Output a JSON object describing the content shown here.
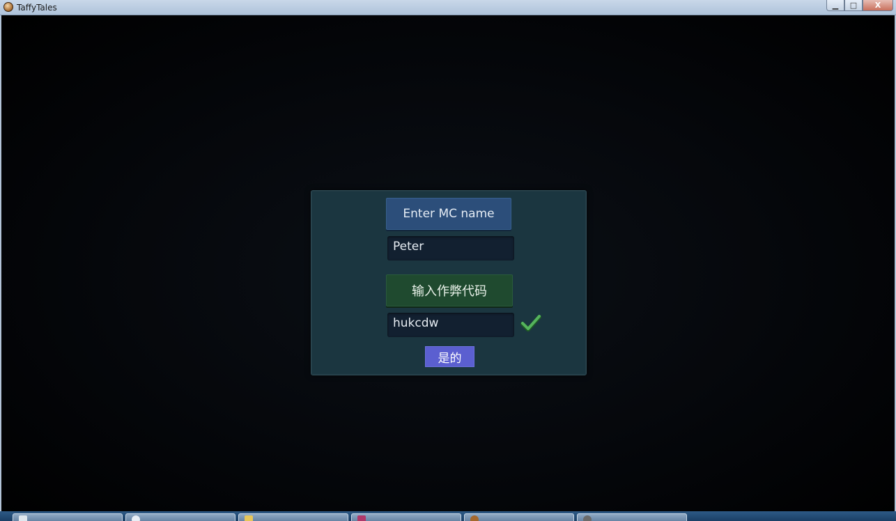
{
  "window": {
    "title": "TaffyTales",
    "controls": {
      "minimize": "▁",
      "maximize": "□",
      "close": "X"
    }
  },
  "dialog": {
    "name_button_label": "Enter MC name",
    "name_value": "Peter",
    "cheat_button_label": "输入作弊代码",
    "cheat_value": "hukcdw",
    "confirm_label": "是的",
    "status_icon": "checkmark-icon"
  },
  "colors": {
    "panel": "#1b3640",
    "name_button": "#2c4e7a",
    "cheat_button": "#1f4a2f",
    "confirm_button": "#5b5fd0",
    "check": "#4caf50"
  },
  "taskbar": {
    "items": [
      {
        "icon": "notepad-icon"
      },
      {
        "icon": "browser-icon"
      },
      {
        "icon": "folder-icon"
      },
      {
        "icon": "archive-icon"
      },
      {
        "icon": "game-icon"
      },
      {
        "icon": "app-icon"
      }
    ]
  }
}
